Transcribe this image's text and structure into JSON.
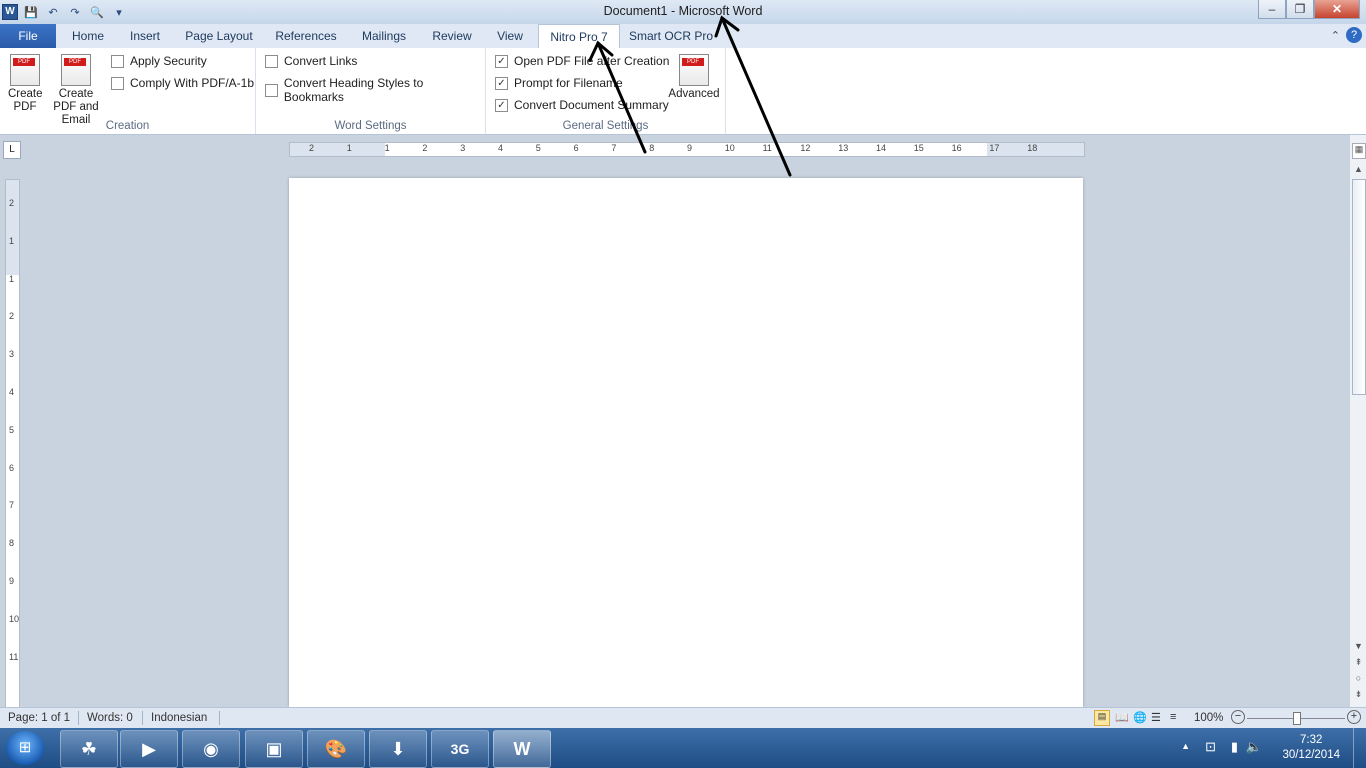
{
  "window": {
    "title": "Document1 - Microsoft Word",
    "app_icon": "W"
  },
  "qat": [
    "save-icon",
    "undo-icon",
    "redo-icon",
    "print-preview-icon",
    "customize-icon"
  ],
  "tabs": [
    {
      "label": "File"
    },
    {
      "label": "Home"
    },
    {
      "label": "Insert"
    },
    {
      "label": "Page Layout"
    },
    {
      "label": "References"
    },
    {
      "label": "Mailings"
    },
    {
      "label": "Review"
    },
    {
      "label": "View"
    },
    {
      "label": "Nitro Pro 7"
    },
    {
      "label": "Smart OCR Pro"
    }
  ],
  "active_tab": "Nitro Pro 7",
  "ribbon": {
    "creation": {
      "label": "Creation",
      "create_pdf": "Create PDF",
      "create_pdf_email": "Create PDF and Email",
      "apply_security": "Apply Security",
      "comply_pdfa": "Comply With PDF/A-1b"
    },
    "word_settings": {
      "label": "Word Settings",
      "convert_links": "Convert Links",
      "convert_heading": "Convert Heading Styles to Bookmarks"
    },
    "general_settings": {
      "label": "General Settings",
      "open_pdf": "Open PDF File after Creation",
      "prompt_filename": "Prompt for Filename",
      "convert_summary": "Convert Document Summary",
      "advanced": "Advanced"
    }
  },
  "ruler": {
    "h_ticks": [
      "2",
      "1",
      "1",
      "2",
      "3",
      "4",
      "5",
      "6",
      "7",
      "8",
      "9",
      "10",
      "11",
      "12",
      "13",
      "14",
      "15",
      "16",
      "17",
      "18"
    ],
    "v_ticks": [
      "2",
      "1",
      "1",
      "2",
      "3",
      "4",
      "5",
      "6",
      "7",
      "8",
      "9",
      "10",
      "11"
    ]
  },
  "status": {
    "page": "Page: 1 of 1",
    "words": "Words: 0",
    "language": "Indonesian",
    "zoom": "100%"
  },
  "taskbar": {
    "apps": [
      "clover-icon",
      "media-player-icon",
      "firefox-icon",
      "monitor-icon",
      "paint-icon",
      "download-manager-icon",
      "3g-modem-icon",
      "word-icon"
    ],
    "time": "7:32",
    "date": "30/12/2014"
  }
}
